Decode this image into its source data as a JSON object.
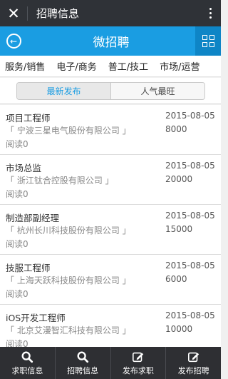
{
  "titlebar": {
    "title": "招聘信息",
    "close_icon": "close-icon",
    "menu_icon": "more-vertical-icon"
  },
  "header": {
    "title": "微招聘",
    "back_icon": "back-circle-icon",
    "grid_icon": "grid-icon"
  },
  "categories": [
    "服务/销售",
    "电子/商务",
    "普工/技工",
    "市场/运营"
  ],
  "tabs": [
    {
      "label": "最新发布",
      "active": true
    },
    {
      "label": "人气最旺",
      "active": false
    }
  ],
  "jobs": [
    {
      "position": "项目工程师",
      "company": "「 宁波三星电气股份有限公司 」",
      "reads": "阅读0",
      "date": "2015-08-05",
      "salary": "8000"
    },
    {
      "position": "市场总监",
      "company": "「 浙江钛合控股有限公司 」",
      "reads": "阅读0",
      "date": "2015-08-05",
      "salary": "20000"
    },
    {
      "position": "制造部副经理",
      "company": "「 杭州长川科技股份有限公司 」",
      "reads": "阅读0",
      "date": "2015-08-05",
      "salary": "15000"
    },
    {
      "position": "技服工程师",
      "company": "「 上海天跃科技股份有限公司 」",
      "reads": "阅读0",
      "date": "2015-08-05",
      "salary": "6000"
    },
    {
      "position": "iOS开发工程师",
      "company": "「 北京艾漫智汇科技有限公司 」",
      "reads": "阅读0",
      "date": "2015-08-05",
      "salary": "10000"
    }
  ],
  "bottom_nav": [
    {
      "label": "求职信息",
      "icon": "search-icon"
    },
    {
      "label": "招聘信息",
      "icon": "search-icon"
    },
    {
      "label": "发布求职",
      "icon": "edit-icon"
    },
    {
      "label": "发布招聘",
      "icon": "edit-icon"
    }
  ]
}
